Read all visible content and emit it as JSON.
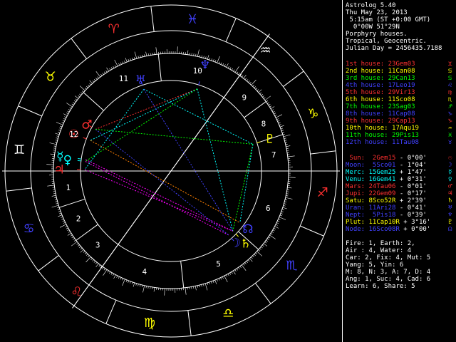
{
  "header": [
    "Astrolog 5.40",
    "Thu May 23, 2013",
    " 5:15am (ST +0:00 GMT)",
    "  0°00W 51°29N",
    "Porphyry houses.",
    "Tropical, Geocentric.",
    "Julian Day = 2456435.7188"
  ],
  "houses": [
    {
      "label": "1st house:",
      "value": "23Gem03",
      "color": "#ff3030",
      "glyph": "♊"
    },
    {
      "label": "2nd house:",
      "value": "11Can08",
      "color": "#ffff00",
      "glyph": "♋"
    },
    {
      "label": "3rd house:",
      "value": "29Can13",
      "color": "#00ff00",
      "glyph": "♋"
    },
    {
      "label": "4th house:",
      "value": "17Leo19",
      "color": "#4040ff",
      "glyph": "♌"
    },
    {
      "label": "5th house:",
      "value": "29Vir13",
      "color": "#ff3030",
      "glyph": "♍"
    },
    {
      "label": "6th house:",
      "value": "11Sco08",
      "color": "#ffff00",
      "glyph": "♏"
    },
    {
      "label": "7th house:",
      "value": "23Sag03",
      "color": "#00ff00",
      "glyph": "♐"
    },
    {
      "label": "8th house:",
      "value": "11Cap08",
      "color": "#4040ff",
      "glyph": "♑"
    },
    {
      "label": "9th house:",
      "value": "29Cap13",
      "color": "#ff3030",
      "glyph": "♑"
    },
    {
      "label": "10th house:",
      "value": "17Aqu19",
      "color": "#ffff00",
      "glyph": "♒"
    },
    {
      "label": "11th house:",
      "value": "29Pis13",
      "color": "#00ff00",
      "glyph": "♓"
    },
    {
      "label": "12th house:",
      "value": "11Tau08",
      "color": "#4040ff",
      "glyph": "♉"
    }
  ],
  "planets": [
    {
      "label": "Sun:",
      "value": "2Gem15",
      "motion": " - 0°00'",
      "color": "#ff3030",
      "glyph": "☉"
    },
    {
      "label": "Moon:",
      "value": "5Sco01",
      "motion": " - 1°04'",
      "color": "#4040ff",
      "glyph": "☽"
    },
    {
      "label": "Merc:",
      "value": "15Gem25",
      "motion": " + 1°47'",
      "color": "#00ffff",
      "glyph": "☿"
    },
    {
      "label": "Venu:",
      "value": "16Gem41",
      "motion": " + 0°31'",
      "color": "#00ffff",
      "glyph": "♀"
    },
    {
      "label": "Mars:",
      "value": "24Tau06",
      "motion": " - 0°01'",
      "color": "#ff3030",
      "glyph": "♂"
    },
    {
      "label": "Jupi:",
      "value": "22Gem09",
      "motion": " - 0°17'",
      "color": "#ff3030",
      "glyph": "♃"
    },
    {
      "label": "Satu:",
      "value": "8Sco52R",
      "motion": " + 2°39'",
      "color": "#ffff00",
      "glyph": "♄"
    },
    {
      "label": "Uran:",
      "value": "11Ari28",
      "motion": " - 0°41'",
      "color": "#4040ff",
      "glyph": "♅"
    },
    {
      "label": "Nept:",
      "value": "5Pis18",
      "motion": " - 0°39'",
      "color": "#4040ff",
      "glyph": "♆"
    },
    {
      "label": "Plut:",
      "value": "11Cap10R",
      "motion": " + 3°16'",
      "color": "#ffff00",
      "glyph": "♇"
    },
    {
      "label": "Node:",
      "value": "16Sco08R",
      "motion": " + 0°00'",
      "color": "#4040ff",
      "glyph": "☊"
    }
  ],
  "summary": [
    "Fire: 1, Earth: 2,",
    "Air : 4, Water: 4",
    "Car: 2, Fix: 4, Mut: 5",
    "Yang: 5, Yin: 6",
    "M: 8, N: 3, A: 7, D: 4",
    "Ang: 1, Suc: 4, Cad: 6",
    "Learn: 6, Share: 5"
  ],
  "chart_data": {
    "type": "astrological-wheel",
    "title": "Astrolog 5.40",
    "house_numbers": [
      "1",
      "2",
      "3",
      "4",
      "5",
      "6",
      "7",
      "8",
      "9",
      "10",
      "11",
      "12"
    ],
    "signs": [
      {
        "name": "Aries",
        "glyph": "♈",
        "color": "#ff3030"
      },
      {
        "name": "Taurus",
        "glyph": "♉",
        "color": "#ffff00"
      },
      {
        "name": "Gemini",
        "glyph": "♊",
        "color": "#ffffff"
      },
      {
        "name": "Cancer",
        "glyph": "♋",
        "color": "#4040ff"
      },
      {
        "name": "Leo",
        "glyph": "♌",
        "color": "#ff3030"
      },
      {
        "name": "Virgo",
        "glyph": "♍",
        "color": "#ffff00"
      },
      {
        "name": "Libra",
        "glyph": "♎",
        "color": "#ffff00"
      },
      {
        "name": "Scorpio",
        "glyph": "♏",
        "color": "#4040ff"
      },
      {
        "name": "Sagittarius",
        "glyph": "♐",
        "color": "#ff3030"
      },
      {
        "name": "Capricorn",
        "glyph": "♑",
        "color": "#ffff00"
      },
      {
        "name": "Aquarius",
        "glyph": "♒",
        "color": "#ffffff"
      },
      {
        "name": "Pisces",
        "glyph": "♓",
        "color": "#4040ff"
      }
    ],
    "ascendant_longitude": 83.05,
    "cusp_longitudes": [
      83.05,
      101.13,
      119.22,
      137.32,
      179.22,
      221.13,
      263.05,
      281.13,
      299.22,
      317.32,
      359.22,
      41.13
    ],
    "planet_positions": [
      {
        "name": "Sun",
        "longitude": 62.25,
        "glyph": "☉",
        "color": "#ff3030"
      },
      {
        "name": "Moon",
        "longitude": 215.02,
        "glyph": "☽",
        "color": "#4040ff"
      },
      {
        "name": "Mercury",
        "longitude": 75.42,
        "glyph": "☿",
        "color": "#00ffff"
      },
      {
        "name": "Venus",
        "longitude": 76.68,
        "glyph": "♀",
        "color": "#00ffff"
      },
      {
        "name": "Mars",
        "longitude": 54.1,
        "glyph": "♂",
        "color": "#ff3030"
      },
      {
        "name": "Jupiter",
        "longitude": 82.15,
        "glyph": "♃",
        "color": "#ff3030"
      },
      {
        "name": "Saturn",
        "longitude": 218.87,
        "glyph": "♄",
        "color": "#ffff00"
      },
      {
        "name": "Uranus",
        "longitude": 11.47,
        "glyph": "♅",
        "color": "#4040ff"
      },
      {
        "name": "Neptune",
        "longitude": 335.3,
        "glyph": "♆",
        "color": "#4040ff"
      },
      {
        "name": "Pluto",
        "longitude": 281.17,
        "glyph": "♇",
        "color": "#ffff00"
      },
      {
        "name": "Node",
        "longitude": 226.13,
        "glyph": "☊",
        "color": "#4040ff"
      }
    ],
    "aspect_lines": [
      {
        "from": "Pluto",
        "to": "Saturn",
        "color": "#00ff00"
      },
      {
        "from": "Neptune",
        "to": "Mars",
        "color": "#ff3030"
      },
      {
        "from": "Neptune",
        "to": "Saturn",
        "color": "#00ffff"
      },
      {
        "from": "Jupiter",
        "to": "Saturn",
        "color": "#ff00ff"
      },
      {
        "from": "Mercury",
        "to": "Saturn",
        "color": "#ff00ff"
      },
      {
        "from": "Venus",
        "to": "Moon",
        "color": "#ff00ff"
      },
      {
        "from": "Sun",
        "to": "Node",
        "color": "#ff8000"
      },
      {
        "from": "Mars",
        "to": "Moon",
        "color": "#4040ff"
      },
      {
        "from": "Uranus",
        "to": "Pluto",
        "color": "#00ffff"
      },
      {
        "from": "Neptune",
        "to": "Sun",
        "color": "#00ffff"
      },
      {
        "from": "Neptune",
        "to": "Venus",
        "color": "#00ff00"
      },
      {
        "from": "Pluto",
        "to": "Mars",
        "color": "#00ff00"
      },
      {
        "from": "Uranus",
        "to": "Jupiter",
        "color": "#00ffff"
      },
      {
        "from": "Uranus",
        "to": "Saturn",
        "color": "#4040ff"
      },
      {
        "from": "Pluto",
        "to": "Node",
        "color": "#00ffff"
      }
    ]
  }
}
